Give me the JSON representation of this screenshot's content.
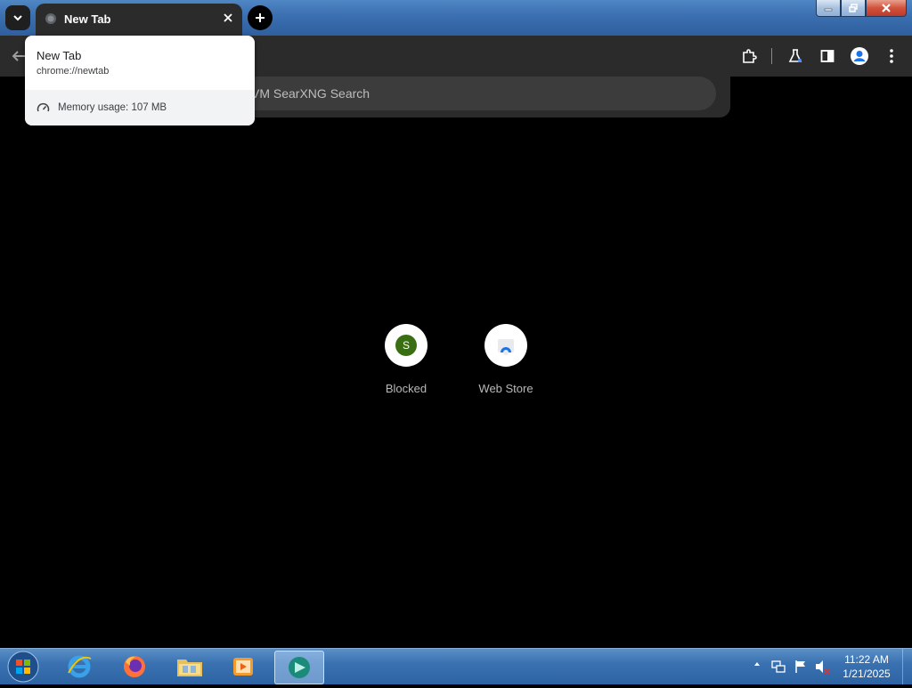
{
  "browser": {
    "tab": {
      "title": "New Tab"
    },
    "search": {
      "placeholder": "Search with KVM SearXNG or type a URL",
      "visible_text": "VM SearXNG Search"
    },
    "hovercard": {
      "title": "New Tab",
      "url": "chrome://newtab",
      "memory": "Memory usage: 107 MB"
    },
    "shortcuts": [
      {
        "label": "Blocked",
        "letter": "S"
      },
      {
        "label": "Web Store"
      }
    ]
  },
  "taskbar": {
    "clock": {
      "time": "11:22 AM",
      "date": "1/21/2025"
    }
  },
  "colors": {
    "page_bg": "#000000",
    "toolbar_bg": "#2b2b2b",
    "taskbar": "#2d63a2",
    "shortcut_letter_bg": "#3a6e12"
  }
}
